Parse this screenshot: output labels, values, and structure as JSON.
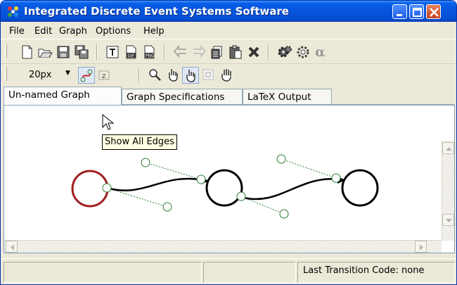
{
  "window": {
    "title": "Integrated Discrete Event Systems Software"
  },
  "menu": [
    "File",
    "Edit",
    "Graph",
    "Options",
    "Help"
  ],
  "toolbar": {
    "zoom_value": "20px",
    "icons1": [
      "new-file-icon",
      "open-folder-icon",
      "save-icon",
      "save-all-icon",
      "text-icon",
      "export-gif-icon",
      "export-png-icon",
      "undo-icon",
      "redo-icon",
      "copy-icon",
      "paste-icon",
      "delete-icon",
      "settings-gear-icon",
      "cogs-icon",
      "alpha-icon"
    ],
    "icons2": [
      "show-all-edges-icon",
      "label-z-icon",
      "zoom-icon",
      "select-hand-icon",
      "pointer-hand-icon",
      "marquee-icon",
      "move-hand-icon"
    ]
  },
  "tabs": [
    {
      "label": "Un-named Graph",
      "active": true
    },
    {
      "label": "Graph Specifications",
      "active": false
    },
    {
      "label": "LaTeX Output",
      "active": false
    }
  ],
  "tooltip": {
    "text": "Show All Edges"
  },
  "status": {
    "transition_code": "Last Transition Code:  none"
  },
  "colors": {
    "initial_state": "#a01e1e",
    "control_points": "#2e7d32",
    "title_bar": "#0654dc"
  }
}
